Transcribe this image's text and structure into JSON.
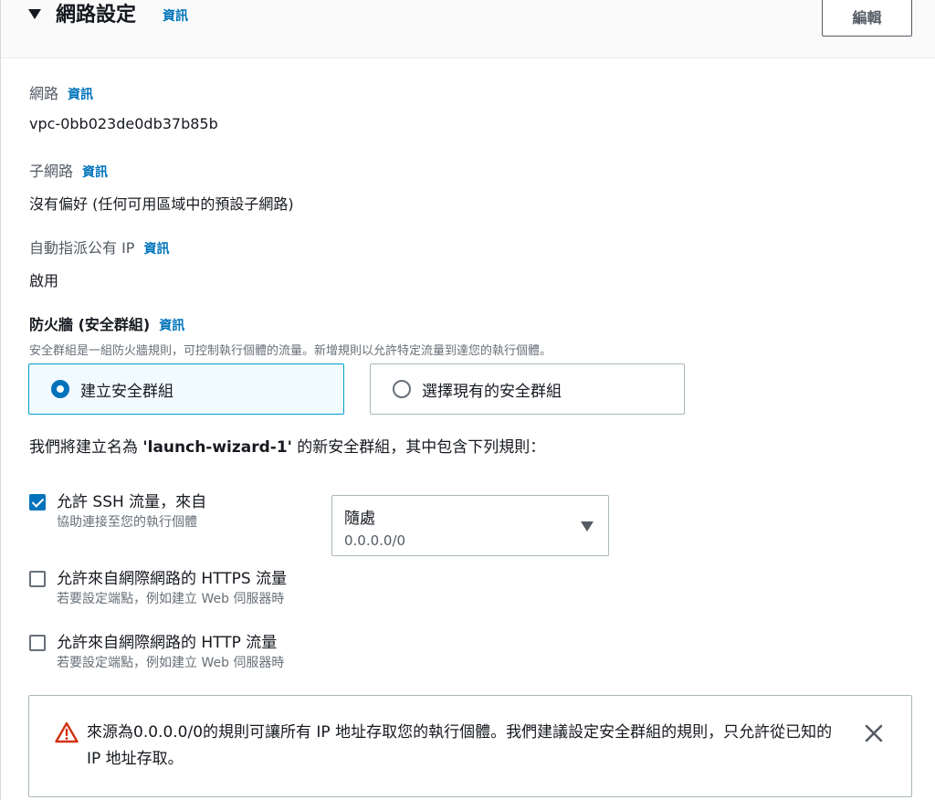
{
  "header": {
    "title": "網路設定",
    "info_label": "資訊",
    "edit_label": "編輯"
  },
  "network": {
    "label": "網路",
    "info_label": "資訊",
    "value": "vpc-0bb023de0db37b85b"
  },
  "subnet": {
    "label": "子網路",
    "info_label": "資訊",
    "value": "沒有偏好 (任何可用區域中的預設子網路)"
  },
  "public_ip": {
    "label": "自動指派公有 IP",
    "info_label": "資訊",
    "value": "啟用"
  },
  "firewall": {
    "title": "防火牆 (安全群組)",
    "info_label": "資訊",
    "description": "安全群組是一組防火牆規則，可控制執行個體的流量。新增規則以允許特定流量到達您的執行個體。",
    "options": [
      {
        "label": "建立安全群組",
        "selected": true
      },
      {
        "label": "選擇現有的安全群組",
        "selected": false
      }
    ],
    "rule_note_prefix": "我們將建立名為 ",
    "rule_note_name": "'launch-wizard-1'",
    "rule_note_suffix": " 的新安全群組，其中包含下列規則："
  },
  "rules": [
    {
      "label": "允許 SSH 流量，來自",
      "description": "協助連接至您的執行個體",
      "checked": true
    },
    {
      "label": "允許來自網際網路的 HTTPS 流量",
      "description": "若要設定端點，例如建立 Web 伺服器時",
      "checked": false
    },
    {
      "label": "允許來自網際網路的 HTTP 流量",
      "description": "若要設定端點，例如建立 Web 伺服器時",
      "checked": false
    }
  ],
  "ssh_source": {
    "label": "隨處",
    "value": "0.0.0.0/0"
  },
  "alert": {
    "text": "來源為0.0.0.0/0的規則可讓所有 IP 地址存取您的執行個體。我們建議設定安全群組的規則，只允許從已知的 IP 地址存取。"
  },
  "colors": {
    "link": "#0073bb",
    "selected_border": "#00a1c9",
    "selected_bg": "#f1faff",
    "warning": "#d13212"
  }
}
